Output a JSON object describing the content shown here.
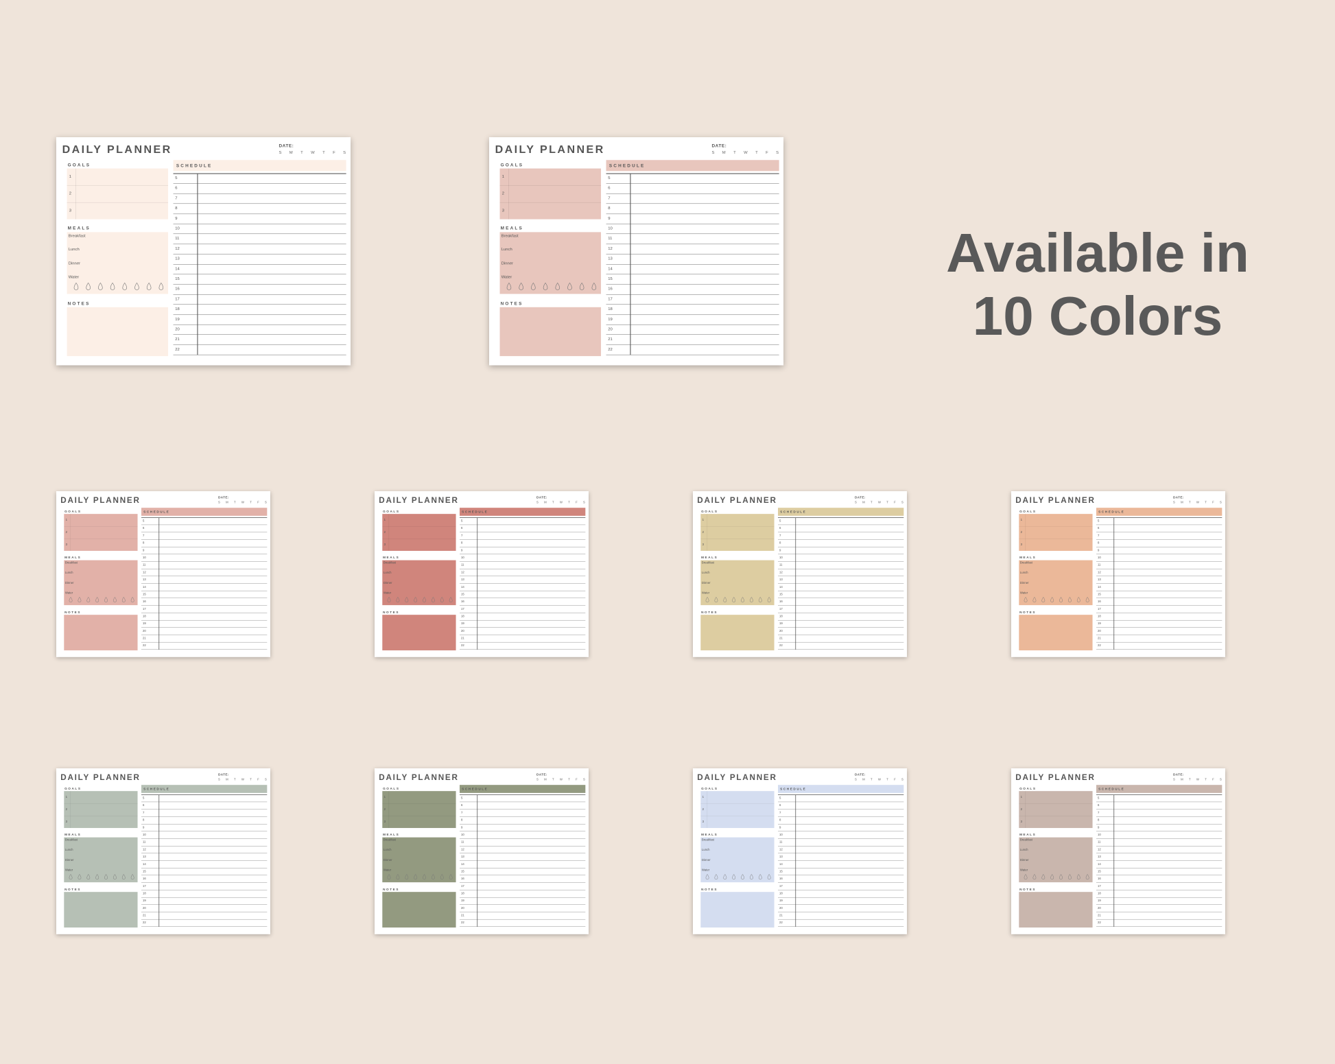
{
  "headline": {
    "line1": "Available in",
    "line2": "10 Colors"
  },
  "planner": {
    "title": "DAILY PLANNER",
    "date_label": "DATE:",
    "days": [
      "S",
      "M",
      "T",
      "W",
      "T",
      "F",
      "S"
    ],
    "goals_label": "GOALS",
    "goal_numbers": [
      "1",
      "2",
      "3"
    ],
    "meals_label": "MEALS",
    "meals": [
      "Breakfast",
      "Lunch",
      "Dinner",
      "Water"
    ],
    "water_drops": 8,
    "notes_label": "NOTES",
    "schedule_label": "SCHEDULE",
    "hours": [
      "5",
      "6",
      "7",
      "8",
      "9",
      "10",
      "11",
      "12",
      "13",
      "14",
      "15",
      "16",
      "17",
      "18",
      "19",
      "20",
      "21",
      "22"
    ]
  },
  "colors": {
    "background": "#efe4da",
    "planners": [
      "#fcefe6",
      "#e8c6bd",
      "#e2b1a8",
      "#d0857c",
      "#ddcda1",
      "#ebb899",
      "#b6c0b5",
      "#939a80",
      "#d4ddf0",
      "#c9b6ad"
    ]
  }
}
